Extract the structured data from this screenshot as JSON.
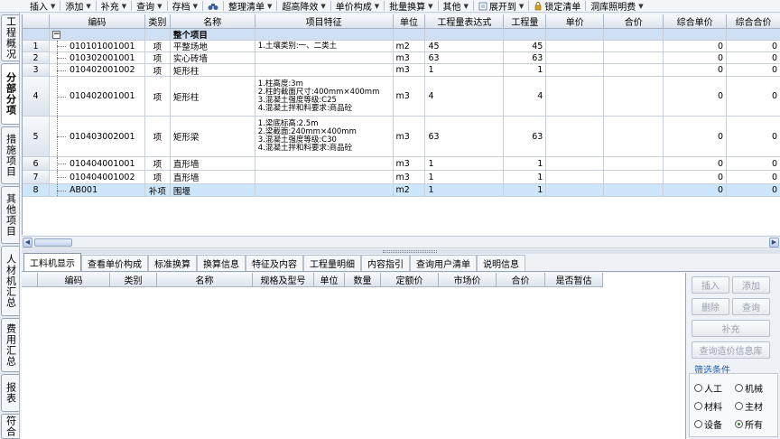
{
  "toolbar": {
    "items": [
      {
        "label": "插入",
        "caret": true
      },
      {
        "label": "添加",
        "caret": true
      },
      {
        "label": "补充",
        "caret": true
      },
      {
        "label": "查询",
        "caret": true
      },
      {
        "label": "存档",
        "caret": true
      },
      {
        "label": "",
        "icon": "binoculars-icon"
      },
      {
        "label": "整理清单",
        "caret": true
      },
      {
        "label": "超高降效",
        "caret": true
      },
      {
        "label": "单价构成",
        "caret": true
      },
      {
        "label": "批量换算",
        "caret": true
      },
      {
        "label": "其他",
        "caret": true
      },
      {
        "label": "展开到",
        "caret": true,
        "icon": "expand-icon"
      },
      {
        "label": "锁定清单",
        "icon": "lock-icon"
      },
      {
        "label": "洞库照明费",
        "caret": true
      }
    ]
  },
  "side_tabs": [
    {
      "label": "工程概况",
      "active": false
    },
    {
      "label": "分部分项",
      "active": true
    },
    {
      "label": "措施项目",
      "active": false
    },
    {
      "label": "其他项目",
      "active": false
    },
    {
      "label": "人材机汇总",
      "active": false
    },
    {
      "label": "费用汇总",
      "active": false
    },
    {
      "label": "报表",
      "active": false
    },
    {
      "label": "符合",
      "active": false
    }
  ],
  "grid": {
    "headers": [
      "",
      "编码",
      "类别",
      "名称",
      "项目特征",
      "单位",
      "工程量表达式",
      "工程量",
      "单价",
      "合价",
      "综合单价",
      "综合合价"
    ],
    "group_label": "整个项目",
    "group_toggle": "−",
    "rows": [
      {
        "num": "1",
        "code": "010101001001",
        "type": "项",
        "name": "平整场地",
        "features": [
          "1.土壤类别:一、二类土"
        ],
        "unit": "m2",
        "expr": "45",
        "qty": "45",
        "price": "",
        "total": "",
        "unit_price": "0",
        "combined": "0"
      },
      {
        "num": "2",
        "code": "010302001001",
        "type": "项",
        "name": "实心砖墙",
        "features": [
          ""
        ],
        "unit": "m3",
        "expr": "63",
        "qty": "63",
        "price": "",
        "total": "",
        "unit_price": "0",
        "combined": "0"
      },
      {
        "num": "3",
        "code": "010402001002",
        "type": "项",
        "name": "矩形柱",
        "features": [
          ""
        ],
        "unit": "m3",
        "expr": "1",
        "qty": "1",
        "price": "",
        "total": "",
        "unit_price": "0",
        "combined": "0"
      },
      {
        "num": "4",
        "code": "010402001001",
        "type": "项",
        "name": "矩形柱",
        "features": [
          "1.柱高度:3m",
          "2.柱的截面尺寸:400mm×400mm",
          "3.混凝土强度等级:C25",
          "4.混凝土拌和料要求:商品砼"
        ],
        "unit": "m3",
        "expr": "4",
        "qty": "4",
        "price": "",
        "total": "",
        "unit_price": "0",
        "combined": "0"
      },
      {
        "num": "5",
        "code": "010403002001",
        "type": "项",
        "name": "矩形梁",
        "features": [
          "1.梁底标高:2.5m",
          "2.梁截面:240mm×400mm",
          "3.混凝土强度等级:C30",
          "4.混凝土拌和料要求:商品砼"
        ],
        "unit": "m3",
        "expr": "63",
        "qty": "63",
        "price": "",
        "total": "",
        "unit_price": "0",
        "combined": "0"
      },
      {
        "num": "6",
        "code": "010404001001",
        "type": "项",
        "name": "直形墙",
        "features": [
          ""
        ],
        "unit": "m3",
        "expr": "1",
        "qty": "1",
        "price": "",
        "total": "",
        "unit_price": "0",
        "combined": "0"
      },
      {
        "num": "7",
        "code": "010404001002",
        "type": "项",
        "name": "直形墙",
        "features": [
          ""
        ],
        "unit": "m3",
        "expr": "1",
        "qty": "1",
        "price": "",
        "total": "",
        "unit_price": "0",
        "combined": "0"
      },
      {
        "num": "8",
        "code": "AB001",
        "type": "补项",
        "name": "围堰",
        "features": [
          ""
        ],
        "unit": "m2",
        "expr": "1",
        "qty": "1",
        "price": "",
        "total": "",
        "unit_price": "0",
        "combined": "0"
      }
    ]
  },
  "bottom_tabs": [
    {
      "label": "工料机显示",
      "active": true
    },
    {
      "label": "查看单价构成",
      "active": false
    },
    {
      "label": "标准换算",
      "active": false
    },
    {
      "label": "换算信息",
      "active": false
    },
    {
      "label": "特征及内容",
      "active": false
    },
    {
      "label": "工程量明细",
      "active": false
    },
    {
      "label": "内容指引",
      "active": false
    },
    {
      "label": "查询用户清单",
      "active": false
    },
    {
      "label": "说明信息",
      "active": false
    }
  ],
  "bottom_grid": {
    "headers": [
      "",
      "编码",
      "类别",
      "名称",
      "规格及型号",
      "单位",
      "数量",
      "定额价",
      "市场价",
      "合价",
      "是否暂估"
    ]
  },
  "right_panel": {
    "insert": "插入",
    "add": "添加",
    "delete": "删除",
    "query": "查询",
    "supplement": "补充",
    "price_lib": "查询造价信息库",
    "filter_title": "筛选条件",
    "filters": [
      {
        "label": "人工",
        "checked": false
      },
      {
        "label": "机械",
        "checked": false
      },
      {
        "label": "材料",
        "checked": false
      },
      {
        "label": "主材",
        "checked": false
      },
      {
        "label": "设备",
        "checked": false
      },
      {
        "label": "所有",
        "checked": true
      }
    ]
  }
}
